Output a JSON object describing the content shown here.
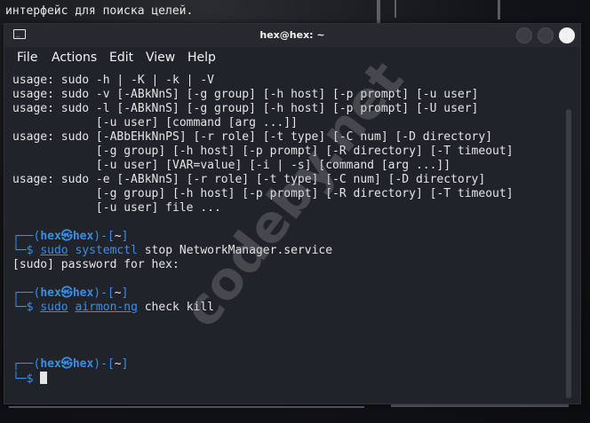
{
  "background": {
    "top_text": "интерфейс для поиска целей."
  },
  "window": {
    "title": "hex@hex: ~",
    "icon": "terminal-icon",
    "controls": [
      "minimize-icon",
      "maximize-icon",
      "close-icon"
    ]
  },
  "menu": [
    "File",
    "Actions",
    "Edit",
    "View",
    "Help"
  ],
  "terminal": {
    "usage_lines": [
      "usage: sudo -h | -K | -k | -V",
      "usage: sudo -v [-ABkNnS] [-g group] [-h host] [-p prompt] [-u user]",
      "usage: sudo -l [-ABkNnS] [-g group] [-h host] [-p prompt] [-U user]",
      "            [-u user] [command [arg ...]]",
      "usage: sudo [-ABbEHkNnPS] [-r role] [-t type] [-C num] [-D directory]",
      "            [-g group] [-h host] [-p prompt] [-R directory] [-T timeout]",
      "            [-u user] [VAR=value] [-i | -s] [command [arg ...]]",
      "usage: sudo -e [-ABkNnS] [-r role] [-t type] [-C num] [-D directory]",
      "            [-g group] [-h host] [-p prompt] [-R directory] [-T timeout]",
      "            [-u user] file ..."
    ],
    "prompt_user": "hex",
    "prompt_host": "hex",
    "prompt_dir": "~",
    "cmd1": {
      "sudo": "sudo",
      "program": "systemctl",
      "args": " stop NetworkManager.service"
    },
    "password_line": "[sudo] password for hex:",
    "cmd2": {
      "sudo": "sudo",
      "program": "airmon-ng",
      "args": " check kill"
    }
  },
  "watermark": "codeby.net",
  "colors": {
    "accent": "#3b8ee8",
    "text": "#e5e5e5",
    "window_bg": "#202329"
  }
}
